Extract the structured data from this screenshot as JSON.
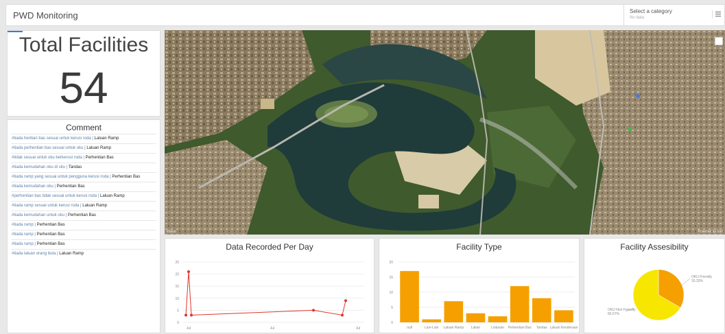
{
  "app": {
    "title": "PWD Monitoring"
  },
  "selector": {
    "label": "Select a category",
    "sub": "No data"
  },
  "total": {
    "label": "Total Facilities",
    "value": "54"
  },
  "comments": {
    "title": "Comment",
    "items": [
      {
        "comment": "#tiada hentian bas sesuai untuk kerusi roda",
        "type": "Laluan Ramp"
      },
      {
        "comment": "#tiada perhentian bas sesuai untuk oku",
        "type": "Laluan Ramp"
      },
      {
        "comment": "#tidak sesuai untuk oku berkerusi roda",
        "type": "Perhentian Bas"
      },
      {
        "comment": "#tiada kemudahan oku di situ",
        "type": "Tandas"
      },
      {
        "comment": "#tiada ramp yang sesuai untuk pengguna kerusi roda",
        "type": "Perhentian Bas"
      },
      {
        "comment": "#tiada kemudahan oku",
        "type": "Perhentian Bas"
      },
      {
        "comment": "#perhentian bas tidak sesuai untuk kerusi roda",
        "type": "Laluan Ramp"
      },
      {
        "comment": "#tiada ramp sesuai untuk kerusi roda",
        "type": "Laluan Ramp"
      },
      {
        "comment": "#tiada kemudahan untuk oku",
        "type": "Perhentian Bas"
      },
      {
        "comment": "#tiada ramp",
        "type": "Perhentian Bas"
      },
      {
        "comment": "#tiada ramp",
        "type": "Perhentian Bas"
      },
      {
        "comment": "#tiada ramp",
        "type": "Perhentian Bas"
      },
      {
        "comment": "#tiada laluan orang buta",
        "type": "Laluan Ramp"
      }
    ]
  },
  "map": {
    "attribution_left": "Maxar",
    "attribution_right": "Powered by Esri"
  },
  "chart_data": [
    {
      "type": "line",
      "title": "Data Recorded Per Day",
      "x": [
        "Jul",
        "",
        "Jul",
        "",
        "Jul"
      ],
      "x_tick_labels": [
        "Jul",
        "Jul",
        "Jul"
      ],
      "series": [
        {
          "values": [
            3,
            21,
            3,
            5,
            3,
            9
          ]
        }
      ],
      "ylim": [
        0,
        25
      ],
      "yticks": [
        0,
        5,
        10,
        15,
        20,
        25
      ],
      "color": "#e0342b"
    },
    {
      "type": "bar",
      "title": "Facility Type",
      "categories": [
        "null",
        "Lain-Lain",
        "Laluan Ramp",
        "Lalian",
        "Lintasan",
        "Perhentian Bas",
        "Tandas",
        "Laluan Kenderaan"
      ],
      "values": [
        17,
        1,
        7,
        3,
        2,
        12,
        8,
        4
      ],
      "ylim": [
        0,
        20
      ],
      "yticks": [
        0,
        5,
        10,
        15,
        20
      ],
      "color": "#f5a000"
    },
    {
      "type": "pie",
      "title": "Facility Assesibility",
      "slices": [
        {
          "label": "OKU Friendly",
          "percent": "33.33%",
          "value": 33.33,
          "color": "#f5a000"
        },
        {
          "label": "OKU Non Friendly",
          "percent": "66.67%",
          "value": 66.67,
          "color": "#f7e600"
        }
      ]
    }
  ]
}
